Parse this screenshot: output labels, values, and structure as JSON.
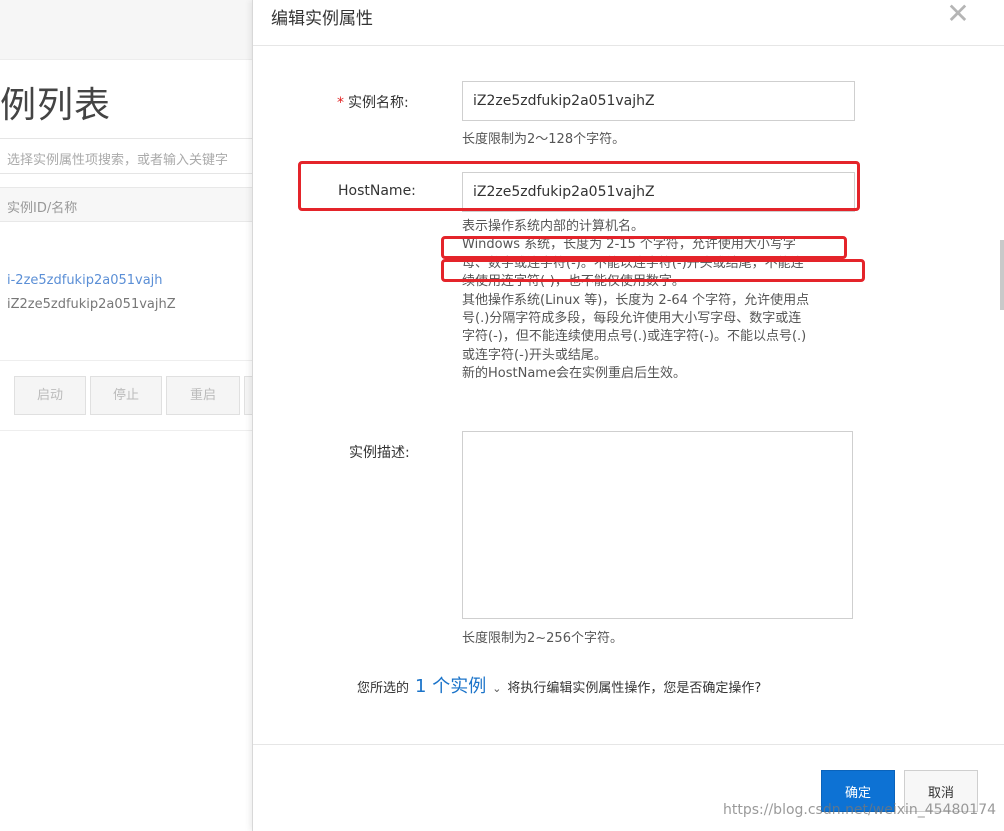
{
  "background": {
    "page_title": "例列表",
    "search_placeholder": "选择实例属性项搜索，或者输入关键字",
    "table_header": "实例ID/名称",
    "instance_id": "i-2ze5zdfukip2a051vajh",
    "instance_name": "iZ2ze5zdfukip2a051vajhZ",
    "buttons": [
      "启动",
      "停止",
      "重启"
    ]
  },
  "dialog": {
    "title": "编辑实例属性",
    "close_icon": "close-icon",
    "fields": {
      "name": {
        "required_mark": "*",
        "label": "实例名称:",
        "value": "iZ2ze5zdfukip2a051vajhZ",
        "hint": "长度限制为2～128个字符。"
      },
      "hostname": {
        "label": "HostName:",
        "value": "iZ2ze5zdfukip2a051vajhZ",
        "hint_lines": [
          "表示操作系统内部的计算机名。",
          "Windows 系统，长度为 2-15 个字符，允许使用大小写字",
          "母、数字或连字符(-)。不能以连字符(-)开头或结尾，不能连",
          "续使用连字符(-)，也不能仅使用数字。",
          "其他操作系统(Linux 等)，长度为 2-64 个字符，允许使用点",
          "号(.)分隔字符成多段，每段允许使用大小写字母、数字或连",
          "字符(-)，但不能连续使用点号(.)或连字符(-)。不能以点号(.)",
          "或连字符(-)开头或结尾。",
          "新的HostName会在实例重启后生效。"
        ]
      },
      "description": {
        "label": "实例描述:",
        "value": "",
        "hint": "长度限制为2~256个字符。"
      }
    },
    "confirm": {
      "prefix": "您所选的",
      "link": "1 个实例",
      "chevron_icon": "chevron-down-icon",
      "suffix": "将执行编辑实例属性操作，您是否确定操作?"
    },
    "footer": {
      "ok_label": "确定",
      "cancel_label": "取消"
    }
  },
  "watermark": "https://blog.csdn.net/weixin_45480174",
  "colors": {
    "primary": "#0d72d4",
    "link": "#1a73c9",
    "annotation": "#e4242a",
    "required": "#e02020"
  }
}
